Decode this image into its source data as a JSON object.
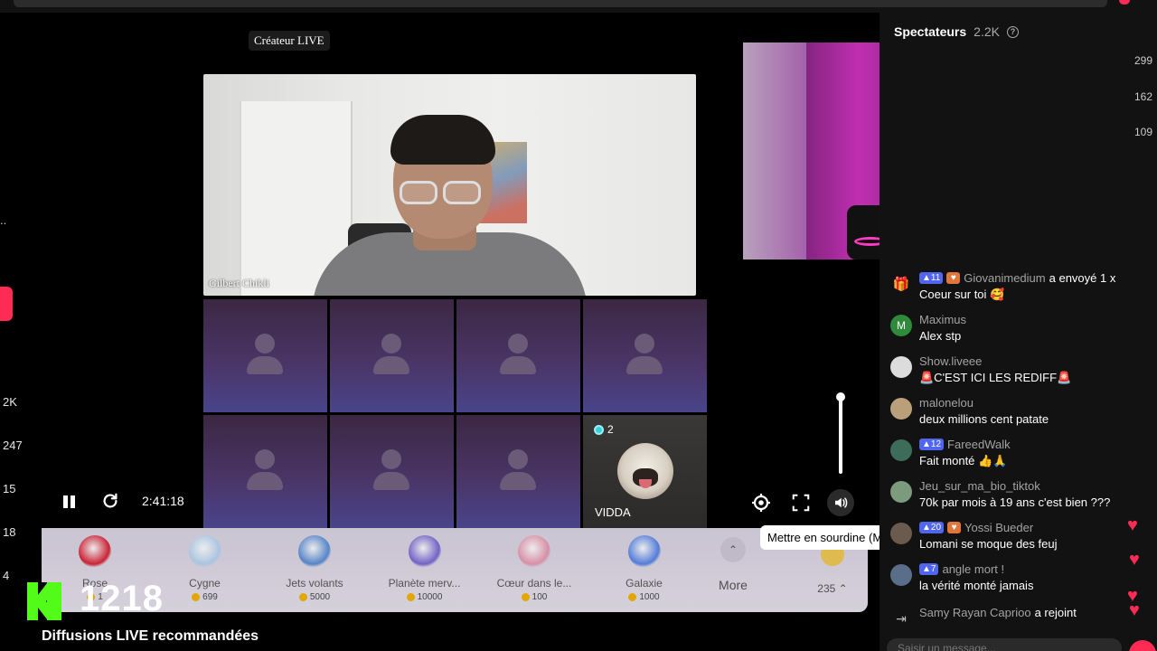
{
  "stage": {
    "creator_tag": "Créateur LIVE",
    "main_guest_name": "Gilbert Chikli",
    "vidda": {
      "count": "2",
      "name": "VIDDA"
    }
  },
  "left_edge": {
    "dots": "..",
    "n1": "2K",
    "n2": "247",
    "n3": "15",
    "n4": "18",
    "n5": "4"
  },
  "right_edge": {
    "n1": "299",
    "n2": "162",
    "n3": "109"
  },
  "player": {
    "timer": "2:41:18",
    "tooltip": "Mettre en sourdine (M)",
    "volume_level": 1.0
  },
  "gifts": [
    {
      "name": "Rose",
      "price": "1",
      "icon": "rose-icon",
      "color": "#d9263b"
    },
    {
      "name": "Cygne",
      "price": "699",
      "icon": "swan-icon",
      "color": "#b7d3f2"
    },
    {
      "name": "Jets volants",
      "price": "5000",
      "icon": "jets-icon",
      "color": "#5d8fd6"
    },
    {
      "name": "Planète merv...",
      "price": "10000",
      "icon": "planet-icon",
      "color": "#7b6ad6"
    },
    {
      "name": "Cœur dans le...",
      "price": "100",
      "icon": "heart-hands-icon",
      "color": "#e89ab3"
    },
    {
      "name": "Galaxie",
      "price": "1000",
      "icon": "galaxy-icon",
      "color": "#5a86e8"
    }
  ],
  "more_label": "More",
  "coins_label": "235",
  "overlay": {
    "viewers": "1218",
    "recommended": "Diffusions LIVE recommandées"
  },
  "sidebar": {
    "title": "Spectateurs",
    "count": "2.2K",
    "messages": [
      {
        "user": "Giovanimedium",
        "badge": "11",
        "heart": true,
        "text": "a envoyé 1 x",
        "text2": "Coeur sur toi 🥰",
        "avatar_color": "#888",
        "gift": true
      },
      {
        "user": "Maximus",
        "badge": "",
        "heart": false,
        "text": "Alex stp",
        "avatar_color": "#2f8a3a",
        "initial": "M"
      },
      {
        "user": "Show.liveee",
        "badge": "",
        "heart": false,
        "text": "🚨C'EST ICI LES REDIFF🚨",
        "avatar_color": "#dcdcdc"
      },
      {
        "user": "malonelou",
        "badge": "",
        "heart": false,
        "text": "deux millions cent patate",
        "avatar_color": "#b9a07a"
      },
      {
        "user": "FareedWalk",
        "badge": "12",
        "heart": false,
        "text": "Fait monté 👍🙏",
        "avatar_color": "#3d6d5a"
      },
      {
        "user": "Jeu_sur_ma_bio_tiktok",
        "badge": "",
        "heart": false,
        "text": "70k par mois à 19 ans c'est bien ???",
        "avatar_color": "#7c9a7d"
      },
      {
        "user": "Yossi Bueder",
        "badge": "20",
        "heart": true,
        "text": "Lomani se moque des feuj",
        "avatar_color": "#6b5b4e"
      },
      {
        "user": "angle mort !",
        "badge": "7",
        "heart": false,
        "text": "la vérité monté jamais",
        "avatar_color": "#5a6e8a"
      },
      {
        "user": "Samy Rayan Caprioo",
        "badge": "",
        "heart": false,
        "text": "a rejoint",
        "avatar_color": "#333",
        "join": true
      }
    ],
    "input_placeholder": "Saisir un message..."
  }
}
